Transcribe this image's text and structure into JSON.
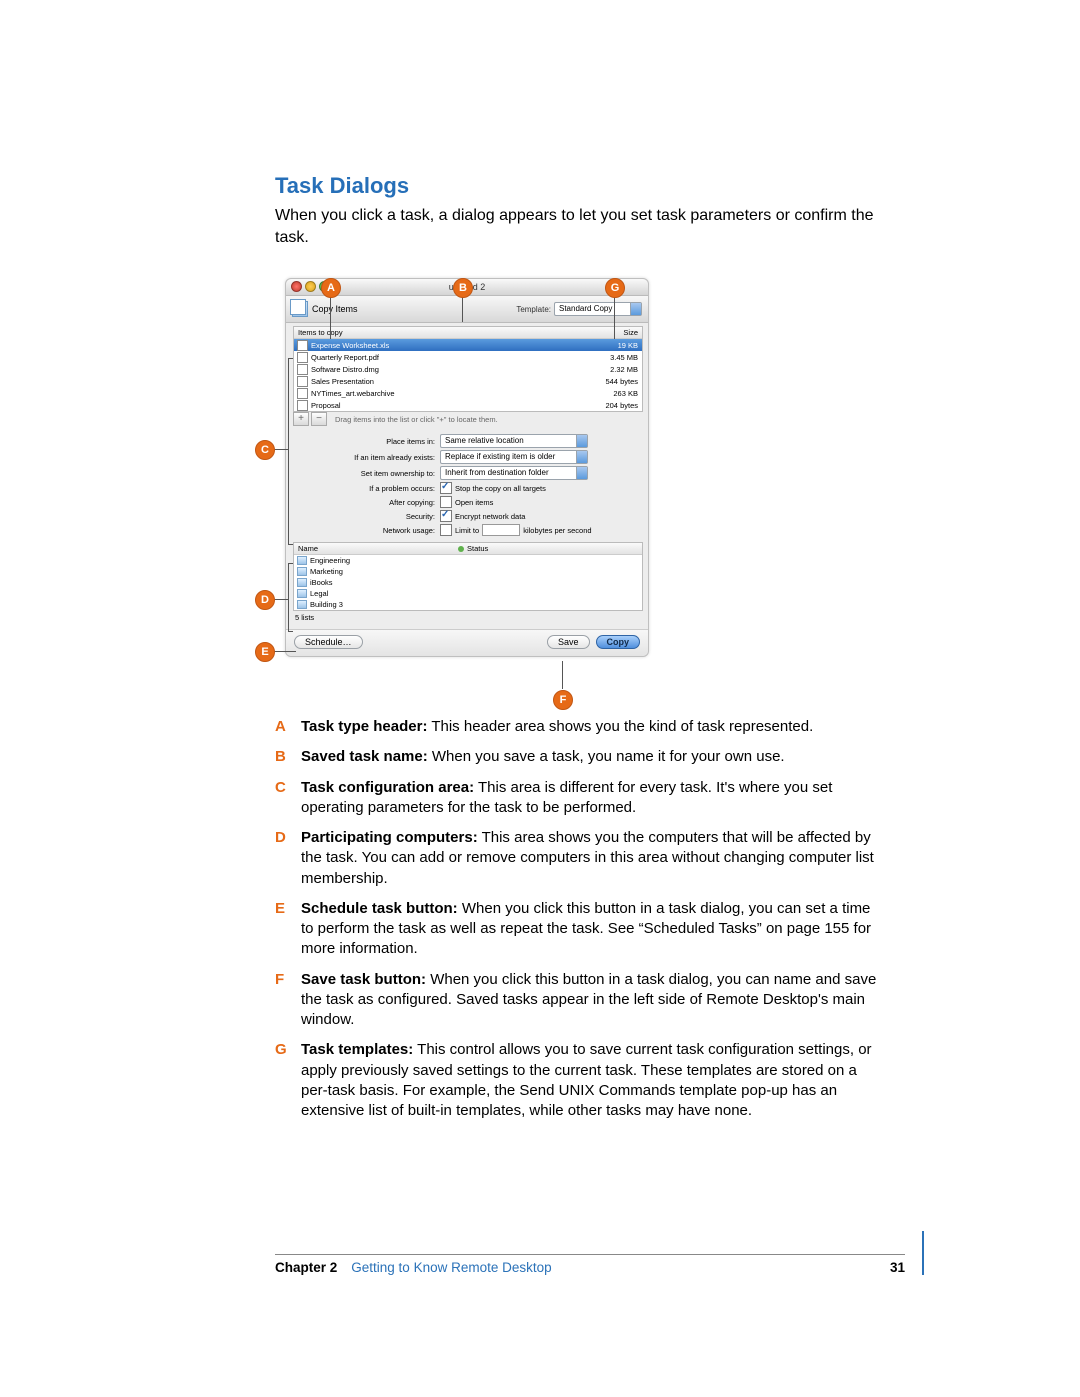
{
  "section_heading": "Task Dialogs",
  "intro_text": "When you click a task, a dialog appears to let you set task parameters or confirm the task.",
  "callouts": {
    "A": "A",
    "B": "B",
    "C": "C",
    "D": "D",
    "E": "E",
    "F": "F",
    "G": "G"
  },
  "dialog": {
    "window_title": "untitled 2",
    "task_header": "Copy Items",
    "template_label": "Template:",
    "template_value": "Standard Copy",
    "items_header_name": "Items to copy",
    "items_header_size": "Size",
    "items": [
      {
        "name": "Expense Worksheet.xls",
        "size": "19 KB",
        "selected": true
      },
      {
        "name": "Quarterly Report.pdf",
        "size": "3.45 MB",
        "selected": false
      },
      {
        "name": "Software Distro.dmg",
        "size": "2.32 MB",
        "selected": false
      },
      {
        "name": "Sales Presentation",
        "size": "544 bytes",
        "selected": false
      },
      {
        "name": "NYTimes_art.webarchive",
        "size": "263 KB",
        "selected": false
      },
      {
        "name": "Proposal",
        "size": "204 bytes",
        "selected": false
      }
    ],
    "add_btn": "+",
    "remove_btn": "−",
    "items_hint": "Drag items into the list or click \"+\" to locate them.",
    "opt_place_label": "Place items in:",
    "opt_place_value": "Same relative location",
    "opt_exists_label": "If an item already exists:",
    "opt_exists_value": "Replace if existing item is older",
    "opt_owner_label": "Set item ownership to:",
    "opt_owner_value": "Inherit from destination folder",
    "opt_problem_label": "If a problem occurs:",
    "opt_problem_value": "Stop the copy on all targets",
    "opt_after_label": "After copying:",
    "opt_after_value": "Open items",
    "opt_security_label": "Security:",
    "opt_security_value": "Encrypt network data",
    "opt_netuse_label": "Network usage:",
    "opt_netuse_value": "Limit to",
    "opt_netuse_unit": "kilobytes per second",
    "computers_header_name": "Name",
    "computers_header_status": "Status",
    "computers": [
      {
        "name": "Engineering"
      },
      {
        "name": "Marketing"
      },
      {
        "name": "iBooks"
      },
      {
        "name": "Legal"
      },
      {
        "name": "Building 3"
      }
    ],
    "computers_count": "5 lists",
    "schedule_btn": "Schedule…",
    "save_btn": "Save",
    "copy_btn": "Copy"
  },
  "definitions": [
    {
      "letter": "A",
      "term": "Task type header:",
      "text": " This header area shows you the kind of task represented."
    },
    {
      "letter": "B",
      "term": "Saved task name:",
      "text": " When you save a task, you name it for your own use."
    },
    {
      "letter": "C",
      "term": "Task configuration area:",
      "text": " This area is different for every task. It's where you set operating parameters for the task to be performed."
    },
    {
      "letter": "D",
      "term": "Participating computers:",
      "text": " This area shows you the computers that will be affected by the task. You can add or remove computers in this area without changing computer list membership."
    },
    {
      "letter": "E",
      "term": "Schedule task button:",
      "text": " When you click this button in a task dialog, you can set a time to perform the task as well as repeat the task. See “Scheduled Tasks” on page 155 for more information."
    },
    {
      "letter": "F",
      "term": "Save task button:",
      "text": " When you click this button in a task dialog, you can name and save the task as configured. Saved tasks appear in the left side of Remote Desktop's main window."
    },
    {
      "letter": "G",
      "term": "Task templates:",
      "text": " This control allows you to save current task configuration settings, or apply previously saved settings to the current task. These templates are stored on a per-task basis. For example, the Send UNIX Commands template pop-up has an extensive list of built-in templates, while other tasks may have none."
    }
  ],
  "footer": {
    "chapter": "Chapter 2",
    "title": "Getting to Know Remote Desktop",
    "page": "31"
  }
}
